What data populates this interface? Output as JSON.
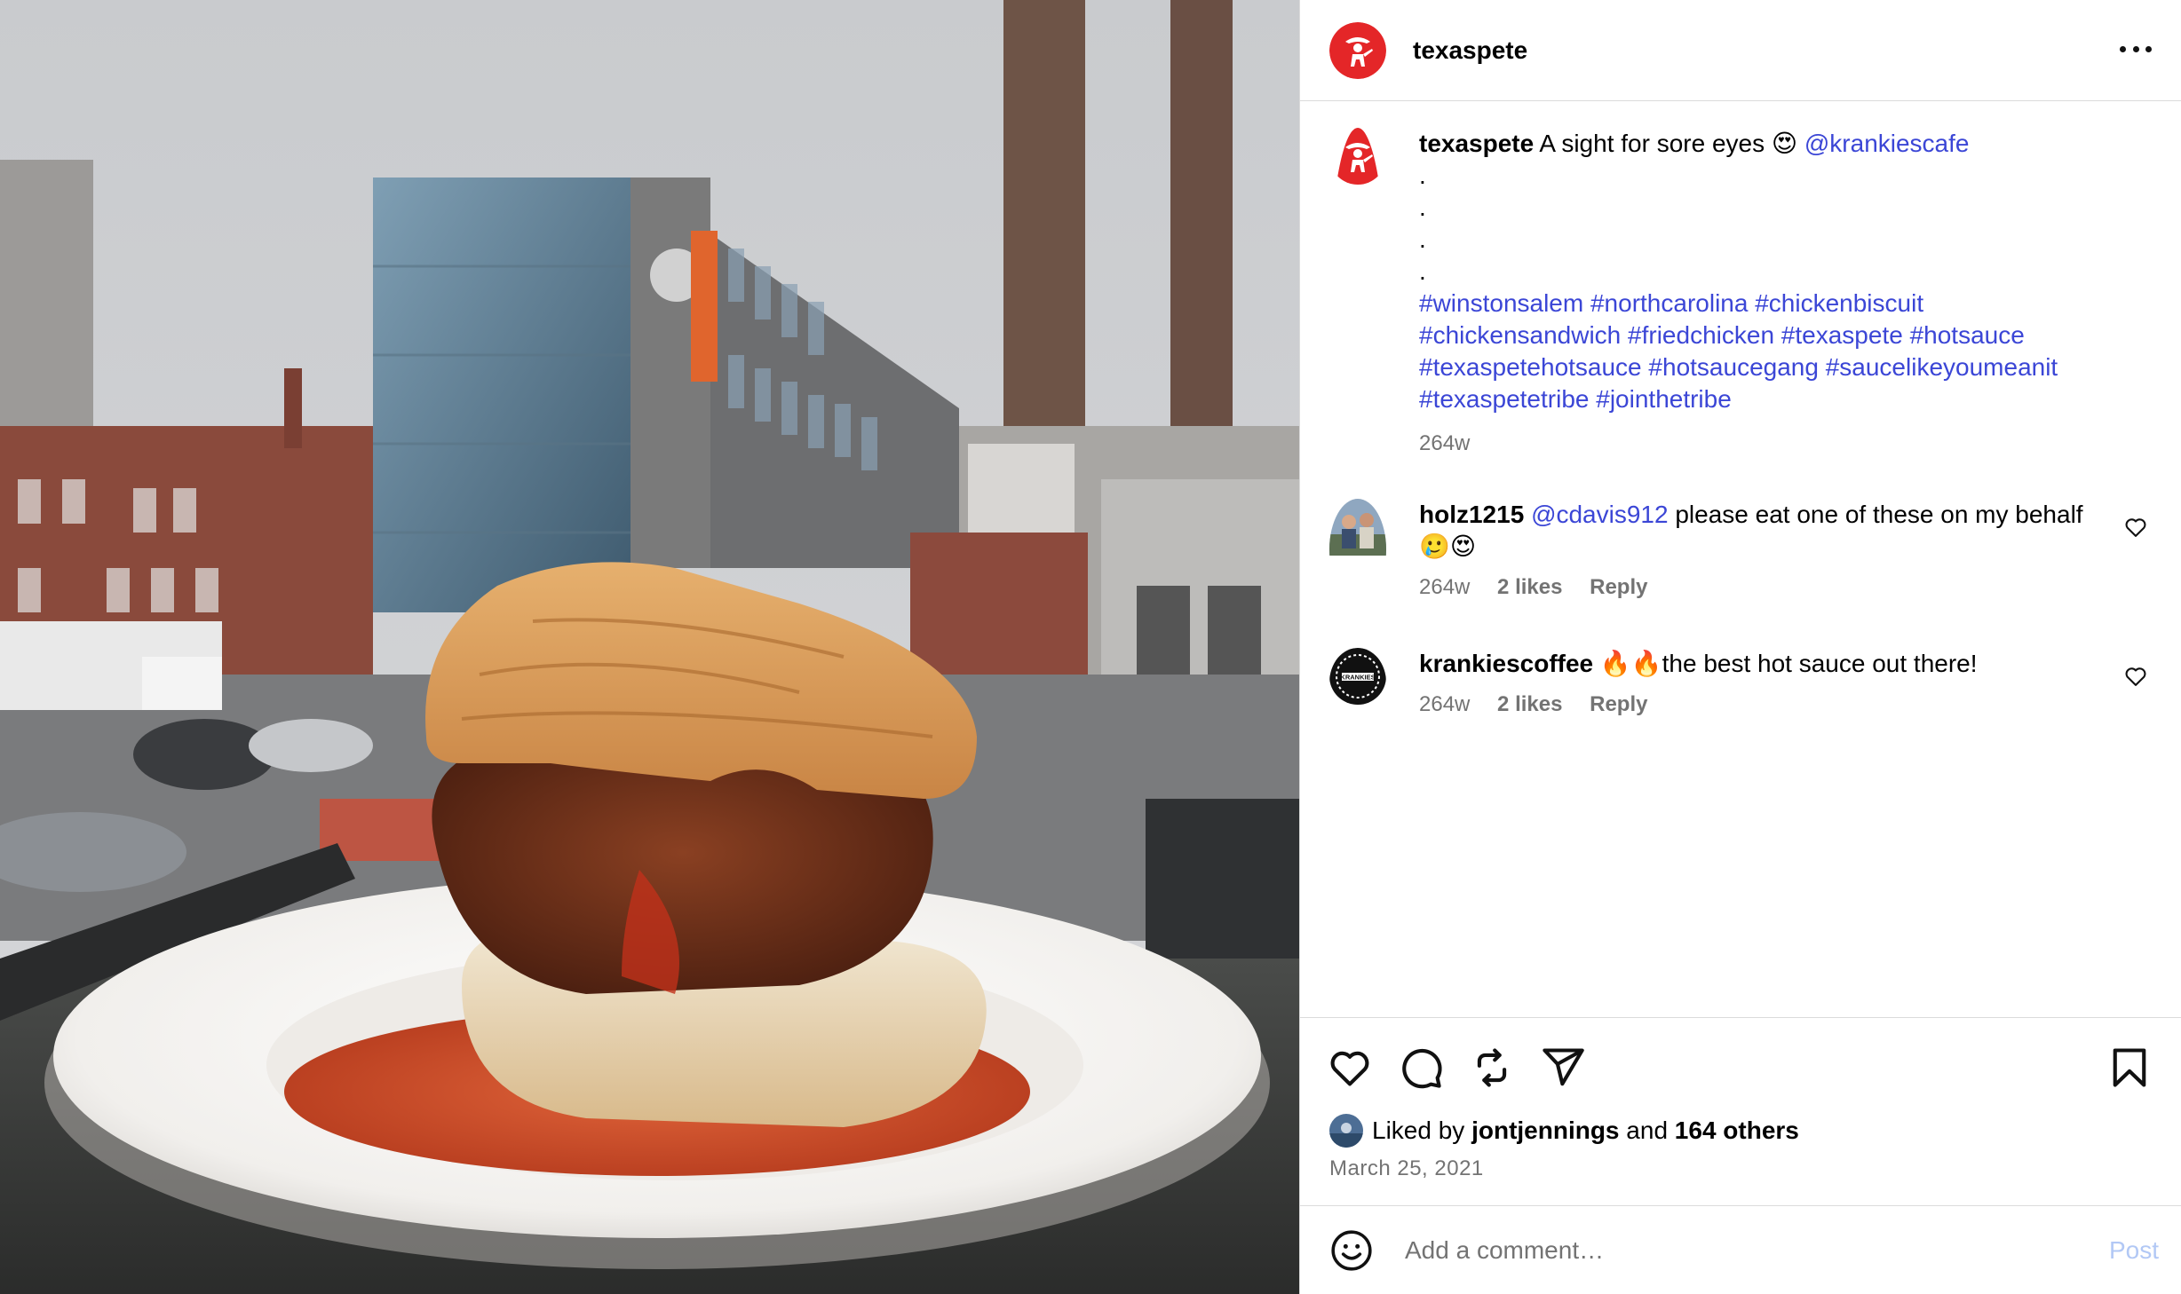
{
  "post": {
    "username": "texaspete",
    "avatar_icon": "texas-pete-cowboy-logo",
    "brand_color": "#e42628"
  },
  "caption": {
    "username": "texaspete",
    "text": "A sight for sore eyes",
    "emoji": "😍",
    "mention": "@krankiescafe",
    "dots": [
      ".",
      ".",
      ".",
      "."
    ],
    "hashtag_lines": [
      [
        "#winstonsalem",
        "#northcarolina",
        "#chickenbiscuit"
      ],
      [
        "#chickensandwich",
        "#friedchicken",
        "#texaspete",
        "#hotsauce"
      ],
      [
        "#texaspetehotsauce",
        "#hotsaucegang",
        "#saucelikeyoumeanit"
      ],
      [
        "#texaspetetribe",
        "#jointhetribe"
      ]
    ],
    "time": "264w"
  },
  "comments": [
    {
      "username": "holz1215",
      "mention": "@cdavis912",
      "text": "please eat one of these on my behalf",
      "emoji": "🥲😍",
      "time": "264w",
      "likes": "2 likes",
      "reply": "Reply"
    },
    {
      "username": "krankiescoffee",
      "emoji": "🔥🔥",
      "text": "the best hot sauce out there!",
      "time": "264w",
      "likes": "2 likes",
      "reply": "Reply",
      "avatar_text": "KRANKIES"
    }
  ],
  "actions": {
    "like_icon": "heart-icon",
    "comment_icon": "comment-bubble-icon",
    "repost_icon": "repost-icon",
    "share_icon": "send-icon",
    "save_icon": "bookmark-icon"
  },
  "likes": {
    "prefix": "Liked by",
    "user": "jontjennings",
    "and": "and",
    "others": "164 others"
  },
  "date": "March 25, 2021",
  "add_comment": {
    "placeholder": "Add a comment…",
    "post_label": "Post"
  },
  "colors": {
    "link": "#3b46d6",
    "muted": "#737373",
    "border": "#dbdbdb",
    "post_disabled": "#b2c8f5"
  }
}
